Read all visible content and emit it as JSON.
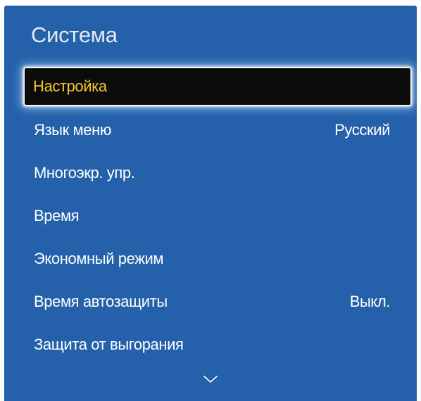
{
  "panel": {
    "title": "Система",
    "background_color": "#2461aa",
    "highlight_text_color": "#f7c62b"
  },
  "menu": {
    "items": [
      {
        "label": "Настройка",
        "value": "",
        "selected": true
      },
      {
        "label": "Язык меню",
        "value": "Русский",
        "selected": false
      },
      {
        "label": "Многоэкр. упр.",
        "value": "",
        "selected": false
      },
      {
        "label": "Время",
        "value": "",
        "selected": false
      },
      {
        "label": "Экономный режим",
        "value": "",
        "selected": false
      },
      {
        "label": "Время автозащиты",
        "value": "Выкл.",
        "selected": false
      },
      {
        "label": "Защита от выгорания",
        "value": "",
        "selected": false
      }
    ]
  },
  "scroll": {
    "icon": "chevron-down-icon"
  }
}
